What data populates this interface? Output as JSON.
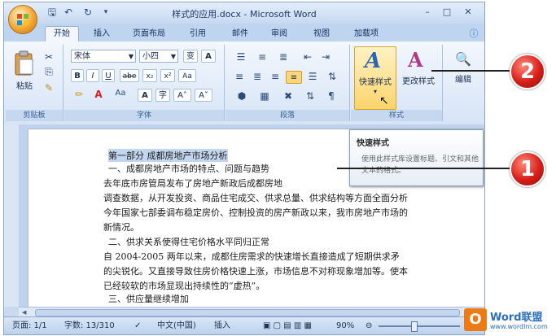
{
  "window": {
    "title": "样式的应用.docx - Microsoft Word"
  },
  "quick_access": {
    "save_icon": "save-icon",
    "undo_icon": "undo-icon",
    "redo_icon": "redo-icon"
  },
  "tabs": [
    {
      "label": "开始",
      "active": true
    },
    {
      "label": "插入"
    },
    {
      "label": "页面布局"
    },
    {
      "label": "引用"
    },
    {
      "label": "邮件"
    },
    {
      "label": "审阅"
    },
    {
      "label": "视图"
    },
    {
      "label": "加载项"
    }
  ],
  "ribbon": {
    "clipboard": {
      "label": "剪贴板",
      "paste": "粘贴"
    },
    "font": {
      "label": "字体",
      "font_name": "宋体",
      "font_size": "小四",
      "buttons": [
        "B",
        "I",
        "U",
        "abe",
        "x₂",
        "x²",
        "Aa"
      ]
    },
    "paragraph": {
      "label": "段落"
    },
    "styles": {
      "label": "样式",
      "quick_styles": "快速样式",
      "change_styles": "更改样式"
    },
    "editing": {
      "label": "编辑"
    }
  },
  "tooltip": {
    "title": "快速样式",
    "body": "使用此样式库设置标题、引文和其他文本的格式。"
  },
  "document": {
    "lines": [
      "第一部分  成都房地产市场分析",
      "一、成都房地产市场的特点、问题与趋势",
      "    去年底市房管局发布了房地产新政后成都房地",
      "调查数据，从开发投资、商品住宅成交、供求总量、供求结构等方面全面分析",
      "今年国家七部委调布稳定房价、控制投资的房产新政以来，我市房地产市场的",
      "新情况。",
      "二、供求关系使得住宅价格水平同归正常",
      "    自 2004-2005 两年以来，成都住房需求的快速增长直接造成了短期供求矛",
      "的尖锐化。又直接导致住房价格快速上涨，市场信息不对称现象增加等。使本",
      "已经较软的市场显现出持续性的“虚热”。",
      "三、供应量继续增加"
    ]
  },
  "status": {
    "page": "页面: 1/1",
    "words": "字数: 13/310",
    "language": "中文(中国)",
    "mode": "插入",
    "zoom": "90%"
  },
  "callouts": {
    "one": "1",
    "two": "2"
  },
  "watermark": {
    "brand": "Word联盟",
    "url": "www.wordlm.com"
  },
  "colors": {
    "ribbon_bg": "#d6e4f6",
    "accent_orange": "#f2a531",
    "callout_red": "#d81e18",
    "selection": "#c3d6f0"
  }
}
